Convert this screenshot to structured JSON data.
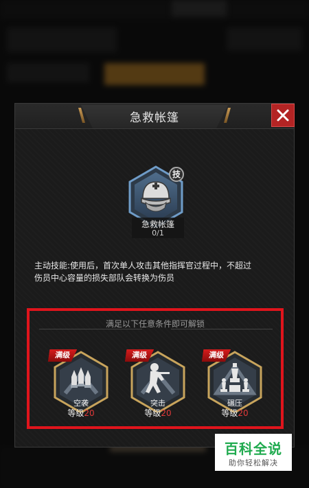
{
  "dialog": {
    "title": "急救帐篷",
    "close_icon": "close-x-icon",
    "accent_color": "#b32424"
  },
  "skill": {
    "icon": "medic-helmet-icon",
    "tag": "技",
    "name": "急救帐篷",
    "count": "0/1"
  },
  "description": {
    "line1": "主动技能:使用后，首次单人攻击其他指挥官过程中，不超过",
    "line2": "伤员中心容量的损失部队会转换为伤员"
  },
  "unlock": {
    "heading": "满足以下任意条件即可解锁",
    "requirements": [
      {
        "badge": "满级",
        "name": "空袭",
        "level_label": "等级",
        "level_value": "20",
        "icon": "missile-salvo-icon"
      },
      {
        "badge": "满级",
        "name": "突击",
        "level_label": "等级",
        "level_value": "20",
        "icon": "assault-soldier-icon"
      },
      {
        "badge": "满级",
        "name": "碾压",
        "level_label": "等级",
        "level_value": "20",
        "icon": "chess-pieces-icon"
      }
    ],
    "highlight_color": "#e0141c"
  },
  "watermark": {
    "title": "百科全说",
    "subtitle": "助你轻松解决"
  }
}
